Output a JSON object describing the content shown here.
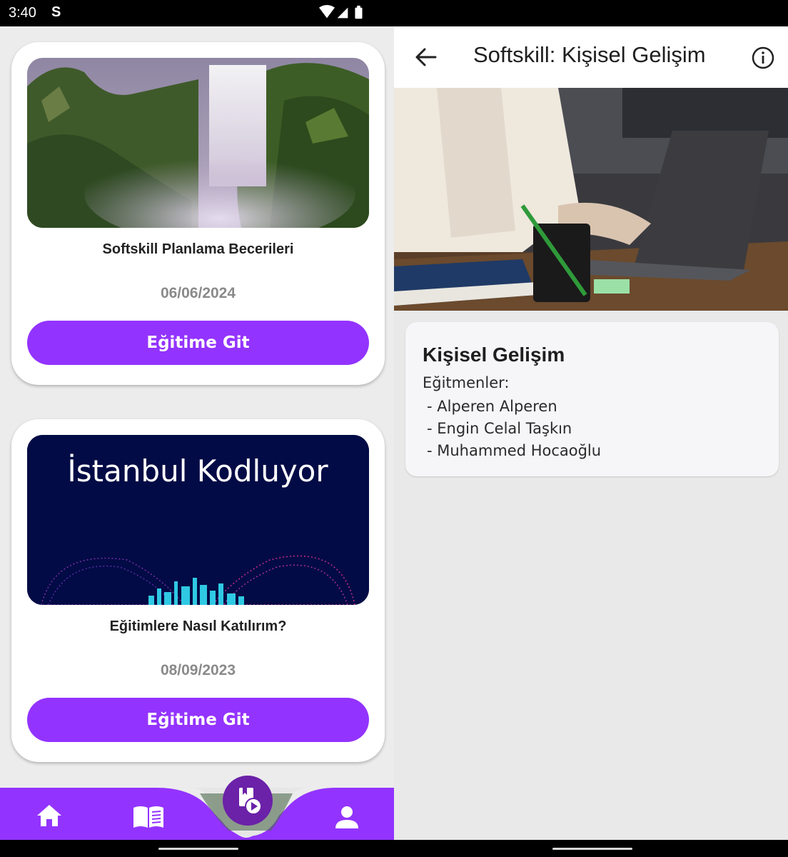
{
  "status_bar": {
    "time": "3:40",
    "carrier_glyph": "S",
    "icons": [
      "wifi-icon",
      "signal-icon",
      "battery-icon"
    ]
  },
  "courses": [
    {
      "title": "Softskill Planlama Becerileri",
      "date": "06/06/2024",
      "button_label": "Eğitime Git",
      "image": "waterfall-photo"
    },
    {
      "title": "Eğitimlere Nasıl Katılırım?",
      "date": "08/09/2023",
      "button_label": "Eğitime Git",
      "image": "istanbul-kodluyor-banner",
      "image_text": "İstanbul Kodluyor"
    }
  ],
  "bottom_nav": {
    "items": [
      "home-icon",
      "book-icon",
      "video-library-icon",
      "person-icon"
    ],
    "active": "video-library-icon",
    "accent": "#9333ff",
    "fab_color": "#6b21a8"
  },
  "detail": {
    "app_bar_title": "Softskill: Kişisel Gelişim",
    "hero_image": "laptop-desk-photo",
    "heading": "Kişisel Gelişim",
    "instructors_label": "Eğitmenler:",
    "instructors": [
      " - Alperen Alperen",
      " - Engin Celal Taşkın",
      " - Muhammed Hocaoğlu"
    ]
  },
  "colors": {
    "accent": "#9333ff",
    "background": "#ececec",
    "card": "#ffffff",
    "banner_navy": "#020b45"
  }
}
